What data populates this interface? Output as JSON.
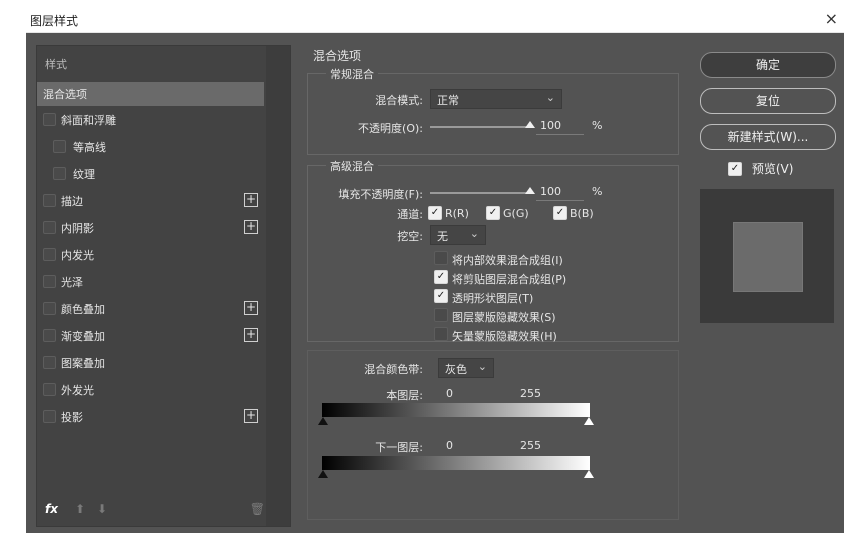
{
  "window": {
    "title": "图层样式",
    "close_symbol": "×"
  },
  "left_panel": {
    "header": "样式",
    "items": [
      {
        "label": "混合选项",
        "active": true,
        "checkbox": false,
        "plus": false
      },
      {
        "label": "斜面和浮雕",
        "active": false,
        "checkbox": true,
        "plus": false
      },
      {
        "label": "等高线",
        "active": false,
        "checkbox": true,
        "plus": false,
        "indent": true
      },
      {
        "label": "纹理",
        "active": false,
        "checkbox": true,
        "plus": false,
        "indent": true
      },
      {
        "label": "描边",
        "active": false,
        "checkbox": true,
        "plus": true
      },
      {
        "label": "内阴影",
        "active": false,
        "checkbox": true,
        "plus": true
      },
      {
        "label": "内发光",
        "active": false,
        "checkbox": true,
        "plus": false
      },
      {
        "label": "光泽",
        "active": false,
        "checkbox": true,
        "plus": false
      },
      {
        "label": "颜色叠加",
        "active": false,
        "checkbox": true,
        "plus": true
      },
      {
        "label": "渐变叠加",
        "active": false,
        "checkbox": true,
        "plus": true
      },
      {
        "label": "图案叠加",
        "active": false,
        "checkbox": true,
        "plus": false
      },
      {
        "label": "外发光",
        "active": false,
        "checkbox": true,
        "plus": false
      },
      {
        "label": "投影",
        "active": false,
        "checkbox": true,
        "plus": true
      }
    ],
    "fx_label": "fx",
    "icons": [
      "fx-icon",
      "arrow-up-icon",
      "arrow-down-icon",
      "trash-icon"
    ]
  },
  "main_panel": {
    "title": "混合选项",
    "general": {
      "group_label": "常规混合",
      "blend_mode_label": "混合模式:",
      "blend_mode_value": "正常",
      "opacity_label": "不透明度(O):",
      "opacity_value": "100",
      "opacity_unit": "%"
    },
    "advanced": {
      "group_label": "高级混合",
      "fill_opacity_label": "填充不透明度(F):",
      "fill_opacity_value": "100",
      "fill_opacity_unit": "%",
      "channels_label": "通道:",
      "channels": [
        "R(R)",
        "G(G)",
        "B(B)"
      ],
      "knockout_label": "挖空:",
      "knockout_value": "无",
      "options": [
        {
          "label": "将内部效果混合成组(I)",
          "checked": false
        },
        {
          "label": "将剪贴图层混合成组(P)",
          "checked": true
        },
        {
          "label": "透明形状图层(T)",
          "checked": true
        },
        {
          "label": "图层蒙版隐藏效果(S)",
          "checked": false
        },
        {
          "label": "矢量蒙版隐藏效果(H)",
          "checked": false
        }
      ]
    },
    "blend_if": {
      "label": "混合颜色带:",
      "value": "灰色",
      "this_layer_label": "本图层:",
      "this_layer_min": "0",
      "this_layer_max": "255",
      "underlying_label": "下一图层:",
      "underlying_min": "0",
      "underlying_max": "255"
    }
  },
  "right_panel": {
    "ok": "确定",
    "reset": "复位",
    "new_style": "新建样式(W)...",
    "preview_label": "预览(V)",
    "preview_checked": true
  },
  "colors": {
    "dialog_bg": "#535353",
    "panel_bg": "#434343",
    "active_item": "#6a6a6a"
  }
}
